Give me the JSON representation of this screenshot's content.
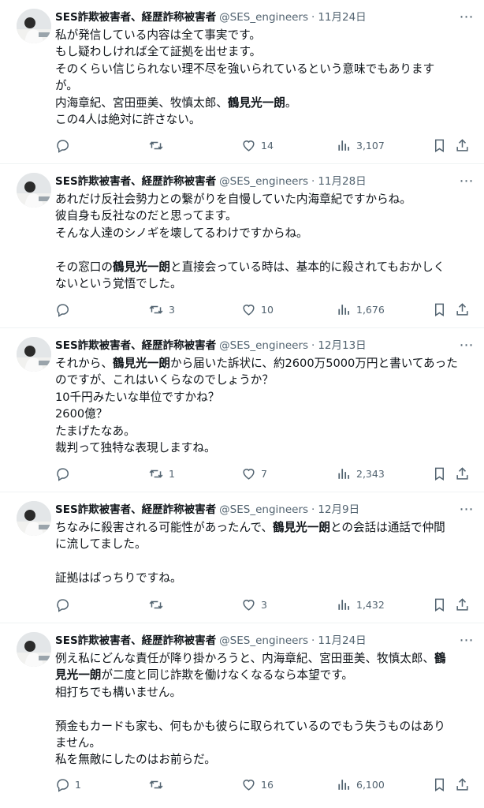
{
  "tweets": [
    {
      "name": "SES詐欺被害者、経歴詐称被害者",
      "handle": "@SES_engineers",
      "sep": "·",
      "date": "11月24日",
      "body": [
        "私が発信している内容は全て事実です。\nもし疑わしければ全て証拠を出せます。\nそのくらい信じられない理不尽を強いられているという意味でもあります\nが。\n内海章紀、宮田亜美、牧慎太郎、",
        "鶴見光一朗",
        "。\nこの4人は絶対に許さない。"
      ],
      "replies": "",
      "retweets": "",
      "likes": "14",
      "views": "3,107"
    },
    {
      "name": "SES詐欺被害者、経歴詐称被害者",
      "handle": "@SES_engineers",
      "sep": "·",
      "date": "11月28日",
      "body": [
        "あれだけ反社会勢力との繋がりを自慢していた内海章紀ですからね。\n彼自身も反社なのだと思ってます。\nそんな人達のシノギを壊してるわけですからね。\n\nその窓口の",
        "鶴見光一朗",
        "と直接会っている時は、基本的に殺されてもおかしく\nないという覚悟でした。"
      ],
      "replies": "",
      "retweets": "3",
      "likes": "10",
      "views": "1,676"
    },
    {
      "name": "SES詐欺被害者、経歴詐称被害者",
      "handle": "@SES_engineers",
      "sep": "·",
      "date": "12月13日",
      "body": [
        "それから、",
        "鶴見光一朗",
        "から届いた訴状に、約2600万5000万円と書いてあった\nのですが、これはいくらなのでしょうか？\n10千円みたいな単位ですかね？\n2600億？\nたまげたなあ。\n裁判って独特な表現しますね。"
      ],
      "replies": "",
      "retweets": "1",
      "likes": "7",
      "views": "2,343"
    },
    {
      "name": "SES詐欺被害者、経歴詐称被害者",
      "handle": "@SES_engineers",
      "sep": "·",
      "date": "12月9日",
      "body": [
        "ちなみに殺害される可能性があったんで、",
        "鶴見光一朗",
        "との会話は通話で仲間\nに流してました。\n\n証拠はばっちりですね。"
      ],
      "replies": "",
      "retweets": "",
      "likes": "3",
      "views": "1,432"
    },
    {
      "name": "SES詐欺被害者、経歴詐称被害者",
      "handle": "@SES_engineers",
      "sep": "·",
      "date": "11月24日",
      "body": [
        "例え私にどんな責任が降り掛かろうと、内海章紀、宮田亜美、牧慎太郎、",
        "鶴\n見光一朗",
        "が二度と同じ詐欺を働けなくなるなら本望です。\n相打ちでも構いません。\n\n預金もカードも家も、何もかも彼らに取られているのでもう失うものはあり\nません。\n私を無敵にしたのはお前らだ。"
      ],
      "replies": "1",
      "retweets": "",
      "likes": "16",
      "views": "6,100"
    }
  ],
  "icons": {
    "reply": "reply-icon",
    "retweet": "retweet-icon",
    "like": "like-icon",
    "views": "views-icon",
    "bookmark": "bookmark-icon",
    "share": "share-icon",
    "more": "more-icon"
  },
  "colors": {
    "text": "#0f1419",
    "secondary": "#536471",
    "divider": "#eff3f4"
  }
}
